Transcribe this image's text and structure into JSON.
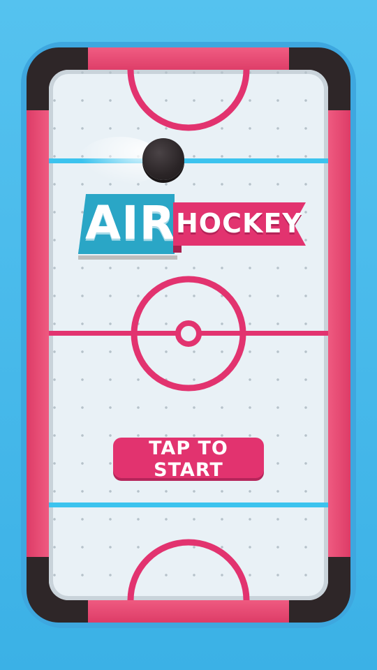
{
  "logo": {
    "air": "AIR",
    "hockey": "HOCKEY"
  },
  "start_button": {
    "label": "TAP TO START"
  },
  "colors": {
    "background": "#4cbdec",
    "rail": "#e8476f",
    "corner": "#2e2628",
    "ice": "#e9f1f6",
    "red_line": "#e2336f",
    "blue_line": "#3cc3ee",
    "logo_teal": "#2aa6c6",
    "logo_pink": "#e2336f",
    "puck": "#2b2527"
  },
  "icons": {
    "puck": "puck-icon"
  }
}
